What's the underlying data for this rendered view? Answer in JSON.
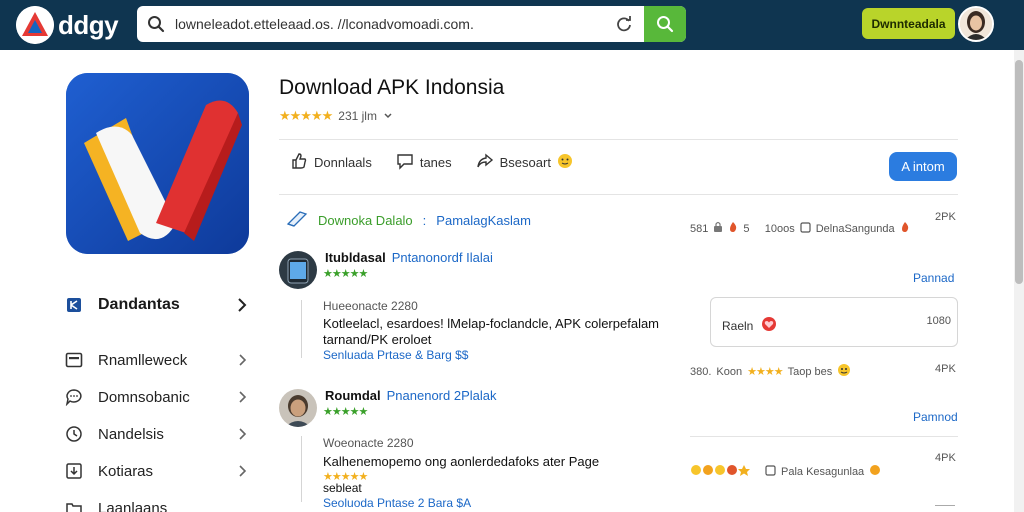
{
  "brand": {
    "name": "ddgy"
  },
  "search": {
    "value": "lowneleadot.etteleaad.os. //lconadvomoadi.com."
  },
  "topbar": {
    "cta_label": "Dwnnteadala"
  },
  "app": {
    "title": "Download APK Indonsia",
    "rating_text": "231 jlm",
    "stars": "★★★★★"
  },
  "actions": {
    "download_label": "Donnlaals",
    "share_label": "tanes",
    "report_label": "Bsesoart",
    "install_label": "A intom"
  },
  "info": {
    "title": "Downoka Dalalo",
    "separator": ":",
    "subtitle": "PamalagKaslam",
    "meta_a": "5     10oos",
    "meta_prefix": "581",
    "meta_b": "DelnaSangunda",
    "size": "2PK"
  },
  "sidebar": {
    "primary": {
      "label": "Dandantas"
    },
    "items": [
      {
        "label": "Rnamlleweck"
      },
      {
        "label": "Domnsobanic"
      },
      {
        "label": "Nandelsis"
      },
      {
        "label": "Kotiaras"
      },
      {
        "label": "Laanlaans"
      }
    ]
  },
  "reviews": [
    {
      "name": "Itubldasal",
      "badge": "Pntanonordf Ilalai",
      "stars": "★★★★★",
      "date": "Hueeonacte 2280",
      "body": "Kotleelacl, esardoes! lMelap-foclandcle, APK colerpefalam tarnand/PK eroloet",
      "foot": "Senluada Prtase & Barg  $$",
      "reply": "Pannad",
      "meta_prefix": "380.",
      "meta_text": "Koon",
      "meta_stars": "★★★★",
      "meta_tail": "Taop bes",
      "size": "4PK"
    },
    {
      "name": "Roumdal",
      "badge": "Pnanenord 2Plalak",
      "stars": "★★★★★",
      "date": "Woeonacte 2280",
      "body": "Kalhenemopemo ong aonlerdedafoks ater Page",
      "body_stars": "★★★★★",
      "body2": "sebleat",
      "foot": "Seoluoda Pntase 2 Bara  $A",
      "reply": "Pamnod",
      "meta_text": "Pala Kesagunlaa",
      "size": "4PK"
    }
  ],
  "side_card": {
    "text": "Raeln",
    "count": "1080"
  }
}
